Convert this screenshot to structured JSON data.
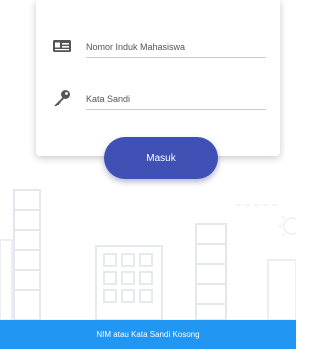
{
  "login_form": {
    "nim_placeholder": "Nomor Induk Mahasiswa",
    "nim_icon": "id-card-icon",
    "password_placeholder": "Kata Sandi",
    "password_icon": "key-icon"
  },
  "login_button": {
    "label": "Masuk"
  },
  "snackbar": {
    "message": "NIM atau Kata Sandi Kosong"
  },
  "colors": {
    "primary": "#3f51b5",
    "snackbar": "#2196f3",
    "skyline": "#e6e9ee"
  }
}
